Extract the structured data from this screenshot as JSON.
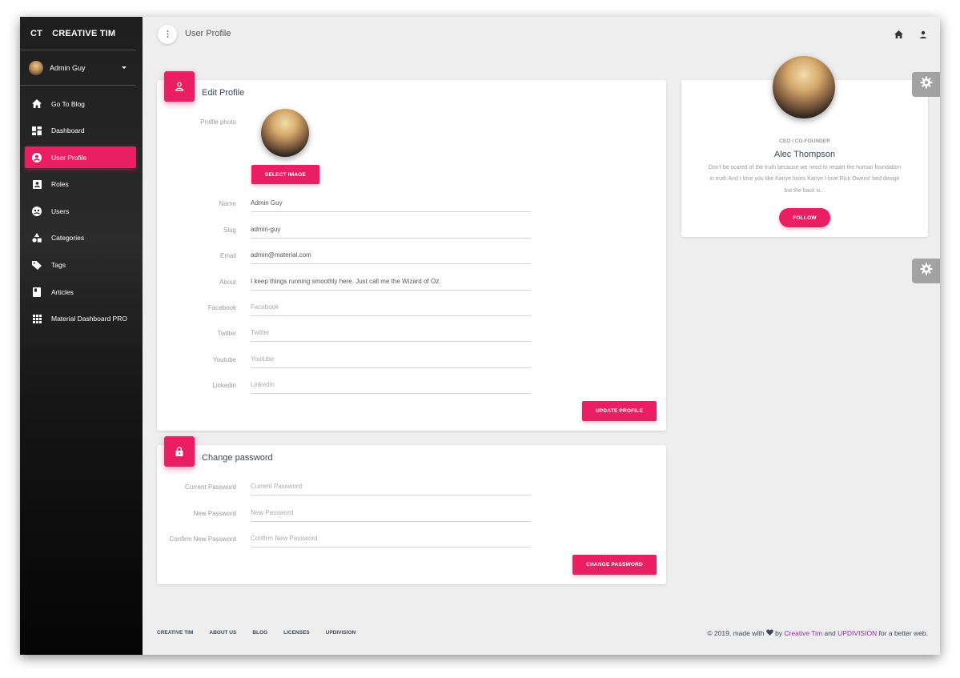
{
  "sidebar": {
    "brand_mini": "CT",
    "brand_name": "CREATIVE TIM",
    "user_name": "Admin Guy",
    "items": [
      {
        "label": "Go To Blog",
        "icon": "home-icon"
      },
      {
        "label": "Dashboard",
        "icon": "dashboard-icon"
      },
      {
        "label": "User Profile",
        "icon": "account-circle-icon",
        "active": true
      },
      {
        "label": "Roles",
        "icon": "assignment-ind-icon"
      },
      {
        "label": "Users",
        "icon": "supervised-user-icon"
      },
      {
        "label": "Categories",
        "icon": "category-icon"
      },
      {
        "label": "Tags",
        "icon": "tag-icon"
      },
      {
        "label": "Articles",
        "icon": "book-icon"
      },
      {
        "label": "Material Dashboard PRO",
        "icon": "apps-icon"
      }
    ]
  },
  "topbar": {
    "title": "User Profile"
  },
  "edit_profile": {
    "title": "Edit Profile",
    "photo_label": "Profile photo",
    "select_image_label": "SELECT IMAGE",
    "fields": [
      {
        "label": "Name",
        "value": "Admin Guy",
        "placeholder": ""
      },
      {
        "label": "Slug",
        "value": "admin-guy",
        "placeholder": ""
      },
      {
        "label": "Email",
        "value": "admin@material.com",
        "placeholder": ""
      },
      {
        "label": "About",
        "value": "I keep things running smoothly here. Just call me the Wizard of Oz.",
        "placeholder": ""
      },
      {
        "label": "Facebook",
        "value": "",
        "placeholder": "Facebook"
      },
      {
        "label": "Twitter",
        "value": "",
        "placeholder": "Twitter"
      },
      {
        "label": "Youtube",
        "value": "",
        "placeholder": "Youtube"
      },
      {
        "label": "Linkedin",
        "value": "",
        "placeholder": "Linkedin"
      }
    ],
    "update_label": "UPDATE PROFILE"
  },
  "change_password": {
    "title": "Change password",
    "fields": [
      {
        "label": "Current Password",
        "placeholder": "Current Password"
      },
      {
        "label": "New Password",
        "placeholder": "New Password"
      },
      {
        "label": "Confirm New Password",
        "placeholder": "Confirm New Password"
      }
    ],
    "button_label": "CHANGE PASSWORD"
  },
  "profile_card": {
    "role": "CEO / CO-FOUNDER",
    "name": "Alec Thompson",
    "bio_line1": "Don't be scared of the truth because we need to restart the human foundation",
    "bio_line2": "in truth And I love you like Kanye loves Kanye I love Rick Owens' bed design",
    "bio_line3": "but the back is...",
    "follow_label": "FOLLOW"
  },
  "footer": {
    "links": [
      "CREATIVE TIM",
      "ABOUT US",
      "BLOG",
      "LICENSES",
      "UPDIVISION"
    ],
    "copy_prefix": "© 2019, made with",
    "copy_by": "by",
    "link1": "Creative Tim",
    "copy_and": "and",
    "link2": "UPDIVISION",
    "copy_suffix": "for a better web."
  },
  "colors": {
    "accent": "#e91e63",
    "link": "#9c27b0",
    "sidebar_bg": "#1a1a1a"
  }
}
